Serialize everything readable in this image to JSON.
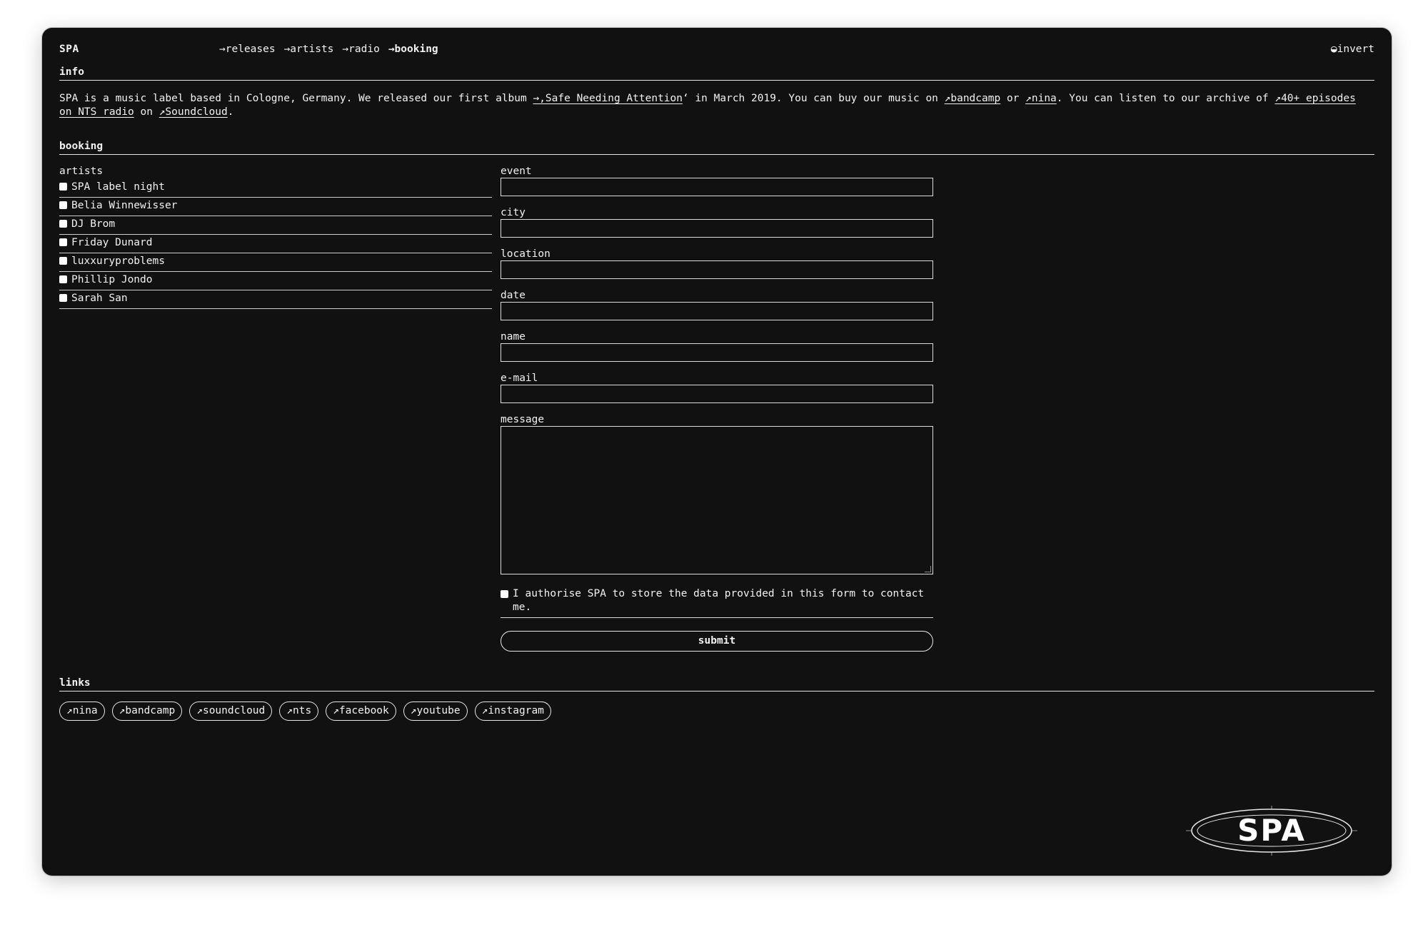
{
  "header": {
    "brand": "SPA",
    "nav": [
      "→releases",
      "→artists",
      "→radio",
      "→booking"
    ],
    "invert": "◒invert"
  },
  "info": {
    "title": "info",
    "text_1": "SPA is a music label based in Cologne, Germany. We released our first album ",
    "album_link": "→‚Safe Needing Attention",
    "text_2": "‘ in March 2019. You can buy our music on ",
    "bandcamp_link": "↗bandcamp",
    "text_3": " or ",
    "nina_link": "↗nina",
    "text_4": ". You can listen to our archive of ",
    "nts_link": "↗40+ episodes on NTS radio",
    "text_5": " on ",
    "soundcloud_link": "↗Soundcloud",
    "text_6": "."
  },
  "booking": {
    "title": "booking",
    "artists_label": "artists",
    "artists": [
      "SPA label night",
      "Belia Winnewisser",
      "DJ Brom",
      "Friday Dunard",
      "luxxuryproblems",
      "Phillip Jondo",
      "Sarah San"
    ],
    "fields": [
      "event",
      "city",
      "location",
      "date",
      "name",
      "e-mail"
    ],
    "message_label": "message",
    "consent": "I authorise SPA to store the data provided in this form to contact me.",
    "submit": "submit"
  },
  "links": {
    "title": "links",
    "items": [
      "↗nina",
      "↗bandcamp",
      "↗soundcloud",
      "↗nts",
      "↗facebook",
      "↗youtube",
      "↗instagram"
    ]
  },
  "logo": {
    "text": "SPA"
  },
  "colors": {
    "background": "#111111",
    "foreground": "#f2f2f2"
  }
}
